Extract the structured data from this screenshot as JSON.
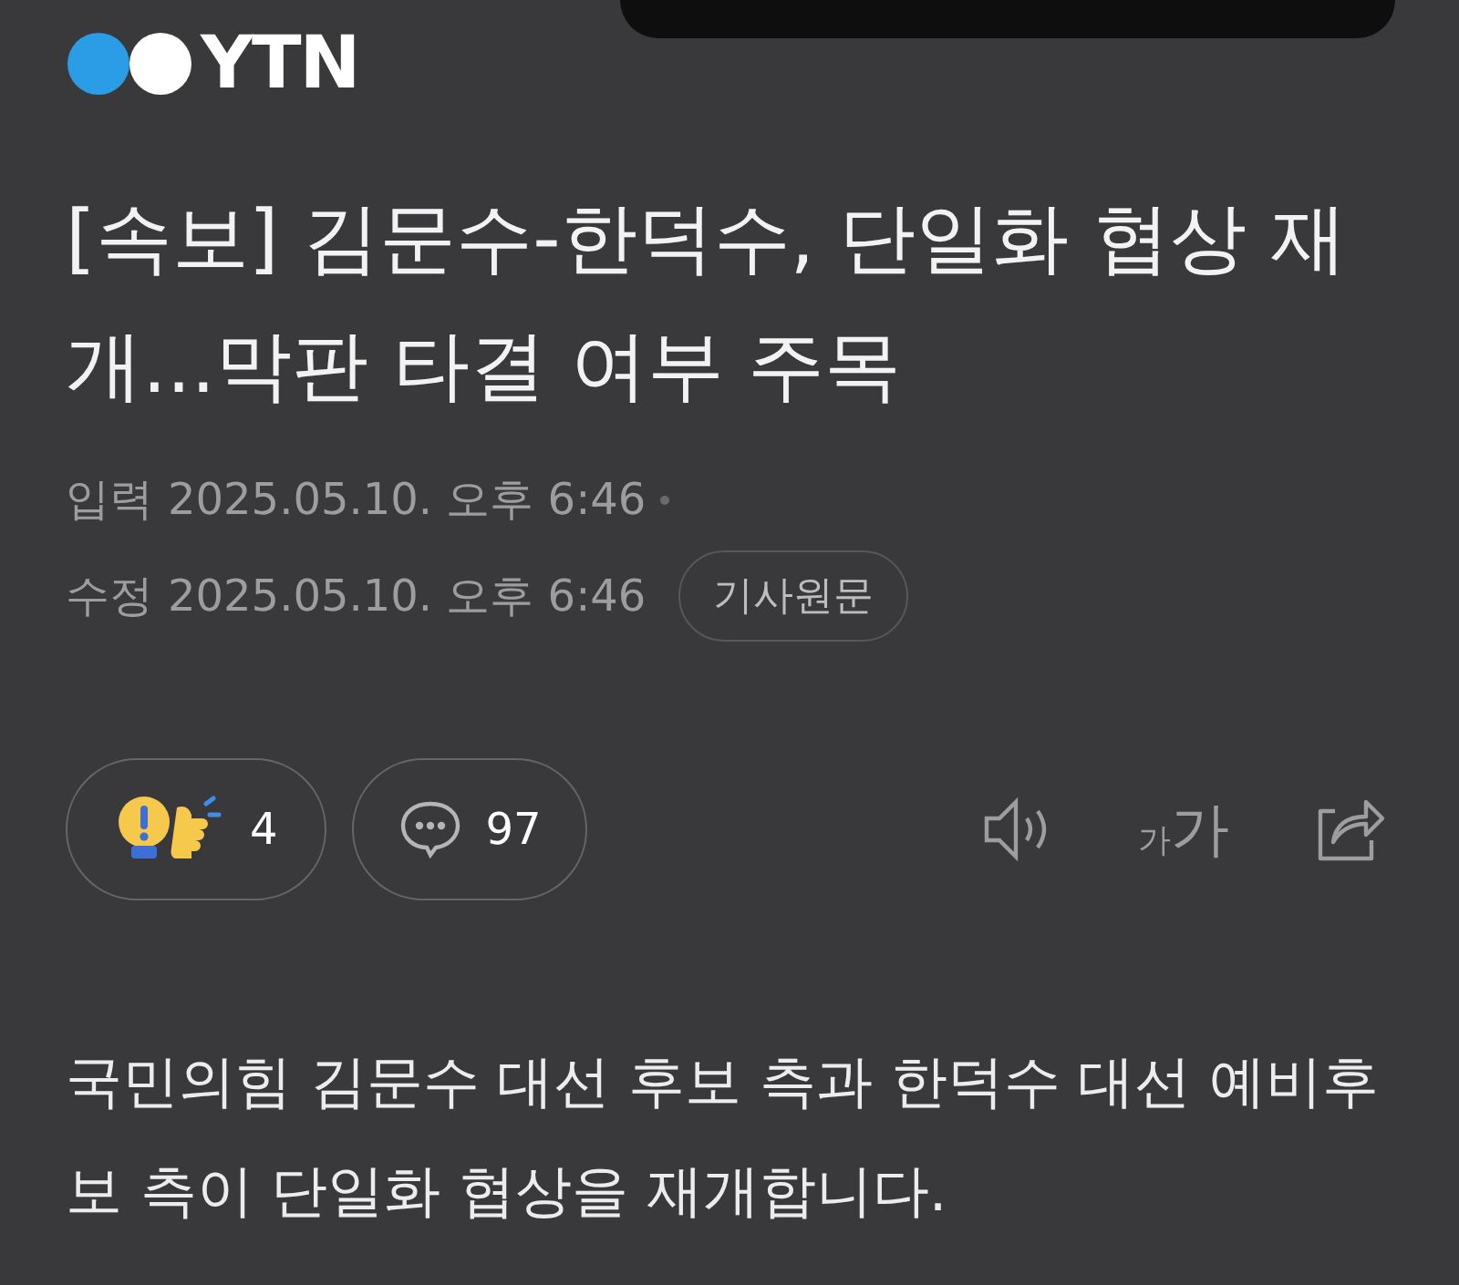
{
  "logo": {
    "text": "YTN"
  },
  "headline": "[속보] 김문수-한덕수, 단일화 협상 재개...막판 타결 여부 주목",
  "meta": {
    "input_label": "입력",
    "input_time": "2025.05.10. 오후 6:46",
    "edit_label": "수정",
    "edit_time": "2025.05.10. 오후 6:46",
    "original_button": "기사원문"
  },
  "actions": {
    "reactions": "4",
    "comments": "97",
    "font_small": "가",
    "font_large": "가"
  },
  "body": "국민의힘 김문수 대선 후보 측과 한덕수 대선 예비후보 측이 단일화 협상을 재개합니다."
}
